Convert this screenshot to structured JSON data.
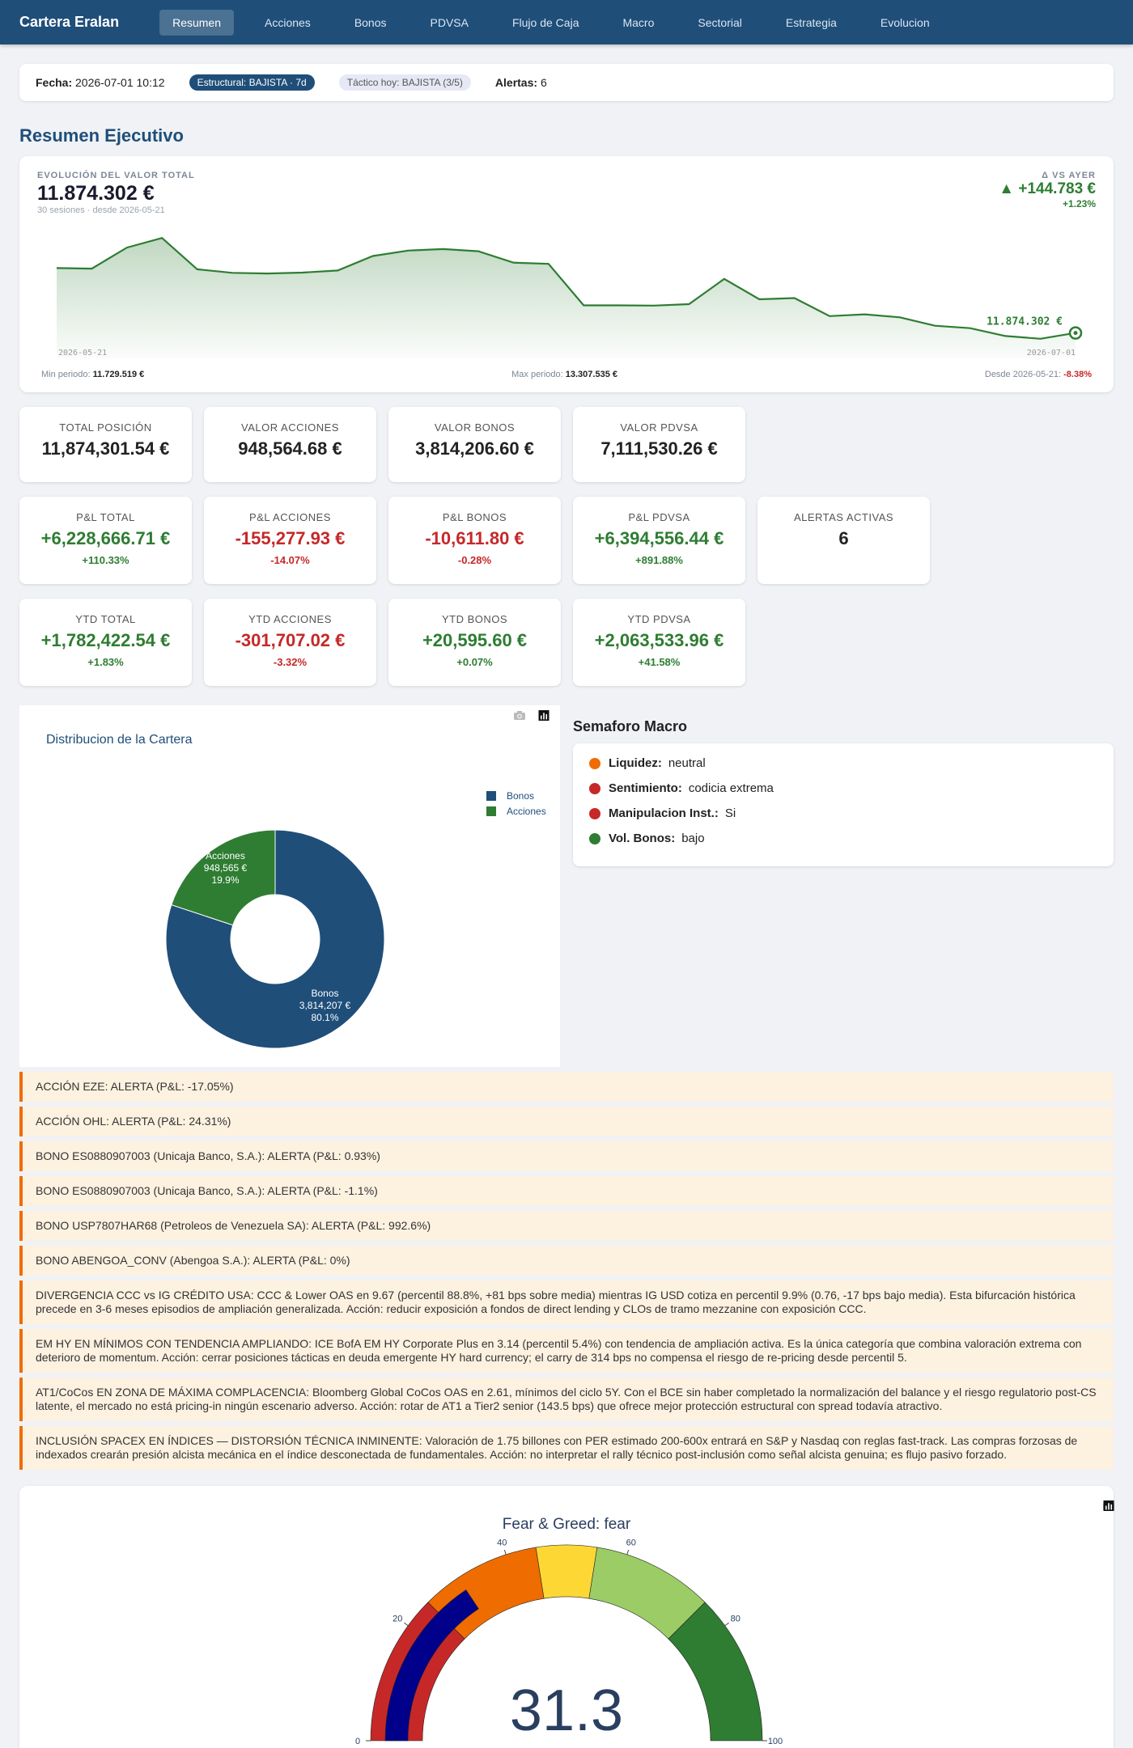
{
  "nav": {
    "brand": "Cartera Eralan",
    "tabs": [
      "Resumen",
      "Acciones",
      "Bonos",
      "PDVSA",
      "Flujo de Caja",
      "Macro",
      "Sectorial",
      "Estrategia",
      "Evolucion"
    ],
    "active": "Resumen"
  },
  "status": {
    "fecha_label": "Fecha:",
    "fecha": "2026-07-01 10:12",
    "estructural": "Estructural: BAJISTA · 7d",
    "tactico": "Táctico hoy: BAJISTA (3/5)",
    "alertas_label": "Alertas:",
    "alertas": "6"
  },
  "section_title": "Resumen Ejecutivo",
  "evolution": {
    "label": "EVOLUCIÓN DEL VALOR TOTAL",
    "value": "11.874.302 €",
    "subtitle": "30 sesiones · desde 2026-05-21",
    "delta_label": "Δ VS AYER",
    "delta": "▲ +144.783 €",
    "delta_pct": "+1.23%",
    "end_label": "11.874.302 €",
    "date_start": "2026-05-21",
    "date_end": "2026-07-01",
    "min_label": "Min periodo:",
    "min_value": "11.729.519 €",
    "max_label": "Max periodo:",
    "max_value": "13.307.535 €",
    "since_label": "Desde 2026-05-21:",
    "since_value": "-8.38%",
    "color": "#2e7d32",
    "series": [
      12950000,
      12945000,
      13120000,
      13200000,
      12940000,
      12910000,
      12905000,
      12912000,
      12930000,
      13050000,
      13095000,
      13108000,
      13090000,
      12995000,
      12985000,
      12640000,
      12640000,
      12638000,
      12650000,
      12860000,
      12690000,
      12700000,
      12550000,
      12565000,
      12540000,
      12470000,
      12450000,
      12385000,
      12362000,
      12410000
    ]
  },
  "cards_row1": [
    {
      "title": "TOTAL POSICIÓN",
      "value": "11,874,301.54 €"
    },
    {
      "title": "VALOR ACCIONES",
      "value": "948,564.68 €"
    },
    {
      "title": "VALOR BONOS",
      "value": "3,814,206.60 €"
    },
    {
      "title": "VALOR PDVSA",
      "value": "7,111,530.26 €"
    }
  ],
  "cards_row2": [
    {
      "title": "P&L TOTAL",
      "value": "+6,228,666.71 €",
      "pct": "+110.33%",
      "sign": "pos"
    },
    {
      "title": "P&L ACCIONES",
      "value": "-155,277.93 €",
      "pct": "-14.07%",
      "sign": "neg"
    },
    {
      "title": "P&L BONOS",
      "value": "-10,611.80 €",
      "pct": "-0.28%",
      "sign": "neg"
    },
    {
      "title": "P&L PDVSA",
      "value": "+6,394,556.44 €",
      "pct": "+891.88%",
      "sign": "pos"
    },
    {
      "title": "ALERTAS ACTIVAS",
      "value": "6",
      "pct": "",
      "sign": ""
    }
  ],
  "cards_row3": [
    {
      "title": "YTD TOTAL",
      "value": "+1,782,422.54 €",
      "pct": "+1.83%",
      "sign": "pos"
    },
    {
      "title": "YTD ACCIONES",
      "value": "-301,707.02 €",
      "pct": "-3.32%",
      "sign": "neg"
    },
    {
      "title": "YTD BONOS",
      "value": "+20,595.60 €",
      "pct": "+0.07%",
      "sign": "pos"
    },
    {
      "title": "YTD PDVSA",
      "value": "+2,063,533.96 €",
      "pct": "+41.58%",
      "sign": "pos"
    }
  ],
  "chart_data": [
    {
      "type": "pie",
      "title": "Distribucion de la Cartera",
      "categories": [
        "Bonos",
        "Acciones"
      ],
      "values": [
        3814207,
        948565
      ],
      "value_labels": [
        "3,814,207 €",
        "948,565 €"
      ],
      "percent_labels": [
        "80.1%",
        "19.9%"
      ],
      "colors": [
        "#1f4e79",
        "#2e7d32"
      ],
      "legend": "top-right",
      "hole": true
    },
    {
      "type": "gauge",
      "title": "Fear & Greed: fear",
      "value": 31.3,
      "range": [
        0,
        100
      ],
      "ticks": [
        0,
        20,
        40,
        60,
        80,
        100
      ],
      "bands": [
        {
          "from": 0,
          "to": 25,
          "color": "#c62828"
        },
        {
          "from": 25,
          "to": 45,
          "color": "#ef6c00"
        },
        {
          "from": 45,
          "to": 55,
          "color": "#fdd835"
        },
        {
          "from": 55,
          "to": 75,
          "color": "#9ccc65"
        },
        {
          "from": 75,
          "to": 100,
          "color": "#2e7d32"
        }
      ],
      "bar_color": "#00008b"
    }
  ],
  "semaforo": {
    "title": "Semaforo Macro",
    "items": [
      {
        "label": "Liquidez:",
        "value": "neutral",
        "color": "#ef6c00"
      },
      {
        "label": "Sentimiento:",
        "value": "codicia extrema",
        "color": "#c62828"
      },
      {
        "label": "Manipulacion Inst.:",
        "value": "Si",
        "color": "#c62828"
      },
      {
        "label": "Vol. Bonos:",
        "value": "bajo",
        "color": "#2e7d32"
      }
    ]
  },
  "alerts": [
    "ACCIÓN EZE: ALERTA (P&L: -17.05%)",
    "ACCIÓN OHL: ALERTA (P&L: 24.31%)",
    "BONO ES0880907003 (Unicaja Banco, S.A.): ALERTA (P&L: 0.93%)",
    "BONO ES0880907003 (Unicaja Banco, S.A.): ALERTA (P&L: -1.1%)",
    "BONO USP7807HAR68 (Petroleos de Venezuela SA): ALERTA (P&L: 992.6%)",
    "BONO ABENGOA_CONV (Abengoa S.A.): ALERTA (P&L: 0%)",
    "DIVERGENCIA CCC vs IG CRÉDITO USA: CCC & Lower OAS en 9.67 (percentil 88.8%, +81 bps sobre media) mientras IG USD cotiza en percentil 9.9% (0.76, -17 bps bajo media). Esta bifurcación histórica precede en 3-6 meses episodios de ampliación generalizada. Acción: reducir exposición a fondos de direct lending y CLOs de tramo mezzanine con exposición CCC.",
    "EM HY EN MÍNIMOS CON TENDENCIA AMPLIANDO: ICE BofA EM HY Corporate Plus en 3.14 (percentil 5.4%) con tendencia de ampliación activa. Es la única categoría que combina valoración extrema con deterioro de momentum. Acción: cerrar posiciones tácticas en deuda emergente HY hard currency; el carry de 314 bps no compensa el riesgo de re-pricing desde percentil 5.",
    "AT1/CoCos EN ZONA DE MÁXIMA COMPLACENCIA: Bloomberg Global CoCos OAS en 2.61, mínimos del ciclo 5Y. Con el BCE sin haber completado la normalización del balance y el riesgo regulatorio post-CS latente, el mercado no está pricing-in ningún escenario adverso. Acción: rotar de AT1 a Tier2 senior (143.5 bps) que ofrece mejor protección estructural con spread todavía atractivo.",
    "INCLUSIÓN SPACEX EN ÍNDICES — DISTORSIÓN TÉCNICA INMINENTE: Valoración de 1.75 billones con PER estimado 200-600x entrará en S&P y Nasdaq con reglas fast-track. Las compras forzosas de indexados crearán presión alcista mecánica en el índice desconectada de fundamentales. Acción: no interpretar el rally técnico post-inclusión como señal alcista genuina; es flujo pasivo forzado."
  ],
  "icons": {
    "camera": "camera-icon",
    "bars": "bar-chart-icon",
    "end_marker": "target-icon"
  }
}
